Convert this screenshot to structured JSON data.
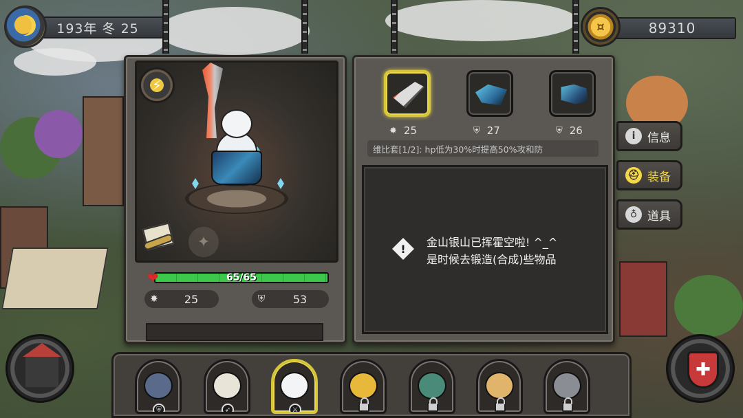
{
  "top_bar": {
    "date_text": "193年 冬 25",
    "gold_amount": "89310"
  },
  "hero": {
    "hp_text": "65/65",
    "hp_fraction": 1.0,
    "attack": "25",
    "defense": "53"
  },
  "equipment": {
    "slots": [
      {
        "icon": "sword-icon",
        "stat_icon": "attack-icon",
        "value": "25",
        "selected": true
      },
      {
        "icon": "armor-icon",
        "stat_icon": "defense-icon",
        "value": "27",
        "selected": false
      },
      {
        "icon": "boots-icon",
        "stat_icon": "defense-icon",
        "value": "26",
        "selected": false
      }
    ],
    "set_bonus": "维比套[1/2]: hp低为30%时提高50%攻和防"
  },
  "message": {
    "line1": "金山银山已挥霍空啦! ^_^",
    "line2": "是时候去锻造(合成)些物品"
  },
  "tabs": [
    {
      "label": "信息",
      "icon": "info-icon",
      "active": false
    },
    {
      "label": "装备",
      "icon": "helmet-icon",
      "active": true
    },
    {
      "label": "道具",
      "icon": "potion-icon",
      "active": false
    }
  ],
  "roster": [
    {
      "name": "boar-pirate",
      "locked": false,
      "selected": false
    },
    {
      "name": "eagle",
      "locked": false,
      "selected": false
    },
    {
      "name": "polar-bear",
      "locked": false,
      "selected": true
    },
    {
      "name": "leopard",
      "locked": true,
      "selected": false
    },
    {
      "name": "crocodile",
      "locked": true,
      "selected": false
    },
    {
      "name": "giraffe",
      "locked": true,
      "selected": false
    },
    {
      "name": "rhino",
      "locked": true,
      "selected": false
    }
  ],
  "colors": {
    "accent_yellow": "#e8d84a",
    "hp_green": "#3cc84a",
    "panel": "#5b5752"
  }
}
